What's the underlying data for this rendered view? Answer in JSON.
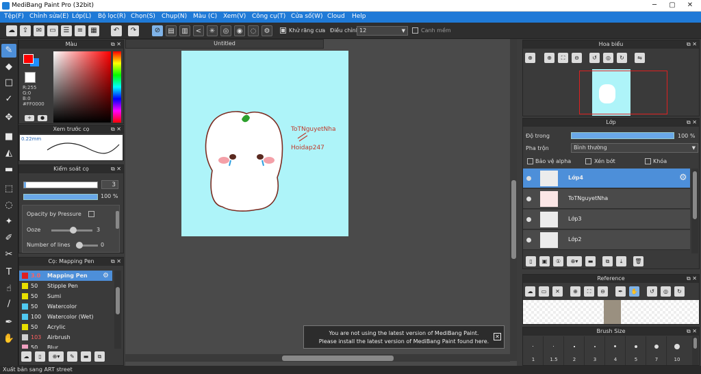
{
  "window": {
    "title": "MediBang Paint Pro (32bit)",
    "minimize": "─",
    "maximize": "▢",
    "close": "✕"
  },
  "menu": [
    "Tệp(F)",
    "Chỉnh sửa(E)",
    "Lớp(L)",
    "Bộ lọc(R)",
    "Chọn(S)",
    "Chụp(N)",
    "Màu (C)",
    "Xem(V)",
    "Công cụ(T)",
    "Cửa số(W)",
    "Cloud",
    "Help"
  ],
  "toolbar": {
    "antialias_label": "Khử răng cưa",
    "adjust_label": "Điều chỉnh",
    "adjust_value": "12",
    "smooth_label": "Canh mềm"
  },
  "color_panel": {
    "title": "Màu",
    "r": "R:255",
    "g": "G:0",
    "b": "B:0",
    "hex": "#FF0000",
    "primary": "#ff0000",
    "secondary": "#1e90ff"
  },
  "brush_preview": {
    "title": "Xem trước cọ",
    "size_label": "0.22mm"
  },
  "brush_control": {
    "title": "Kiểm soát cọ",
    "size_value": "3",
    "opacity_value": "100 %",
    "opacity_by_pressure": "Opacity by Pressure",
    "ooze_label": "Ooze",
    "ooze_value": "3",
    "lines_label": "Number of lines",
    "lines_value": "0"
  },
  "brush_list": {
    "title": "Cọ: Mapping Pen",
    "items": [
      {
        "size": "3.0",
        "name": "Mapping Pen",
        "color": "#e02020"
      },
      {
        "size": "50",
        "name": "Stipple Pen",
        "color": "#e8e000"
      },
      {
        "size": "50",
        "name": "Sumi",
        "color": "#e8e000"
      },
      {
        "size": "50",
        "name": "Watercolor",
        "color": "#50c8f0"
      },
      {
        "size": "100",
        "name": "Watercolor (Wet)",
        "color": "#50c8f0"
      },
      {
        "size": "50",
        "name": "Acrylic",
        "color": "#e8e000"
      },
      {
        "size": "103",
        "name": "Airbrush",
        "color": "#d0d0d0"
      },
      {
        "size": "50",
        "name": "Blur",
        "color": "#f0a0c0"
      }
    ]
  },
  "document": {
    "tab": "Untitled",
    "art_text1": "ToTNguyetNha",
    "art_text2": "Hoidap247",
    "bg": "#aef4f9"
  },
  "notification": {
    "line1": "You are not using the latest version of MediBang Paint.",
    "line2": "Please install the latest version of MediBang Paint found here.",
    "close": "✕"
  },
  "navigator": {
    "title": "Hoa biểu"
  },
  "layer_panel": {
    "title": "Lớp",
    "opacity_label": "Độ trong",
    "opacity_value": "100 %",
    "blend_label": "Pha trộn",
    "blend_value": "Bình thường",
    "protect_alpha": "Bảo vệ alpha",
    "clipping": "Xén bớt",
    "lock": "Khóa",
    "layers": [
      "Lớp4",
      "ToTNguyetNha",
      "Lớp3",
      "Lớp2"
    ]
  },
  "reference": {
    "title": "Reference"
  },
  "brush_size": {
    "title": "Brush Size",
    "sizes": [
      "1",
      "1.5",
      "2",
      "3",
      "4",
      "5",
      "7",
      "10"
    ]
  },
  "status": {
    "text": "Xuất bản sang ART street"
  }
}
